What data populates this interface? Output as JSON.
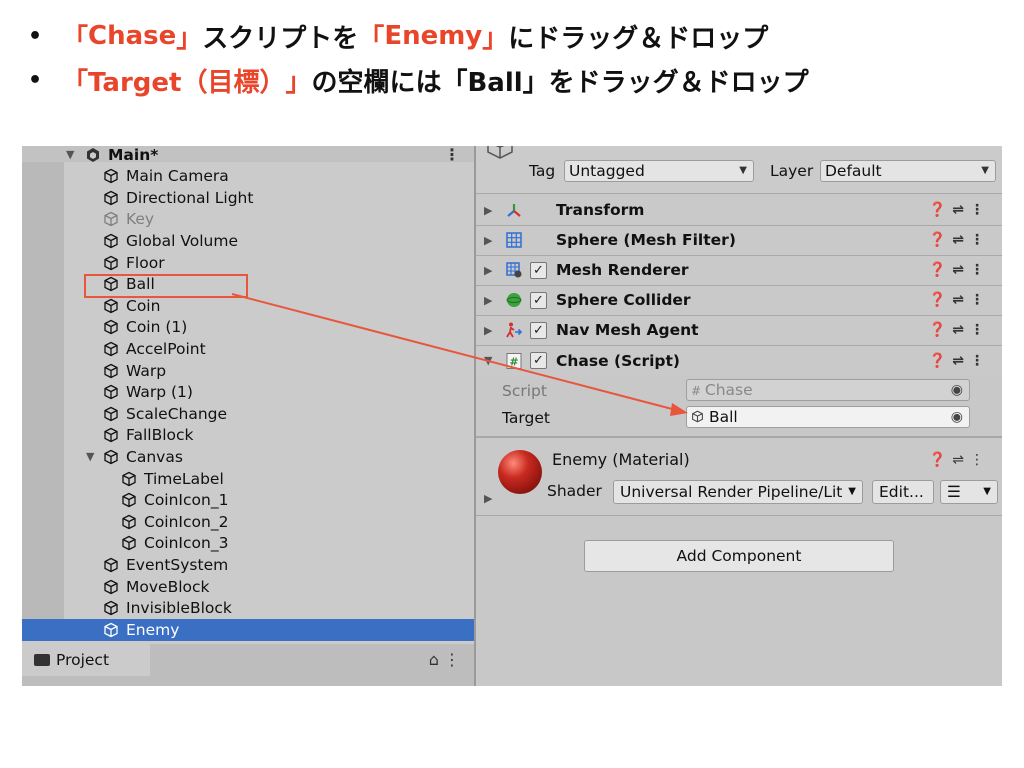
{
  "instructions": [
    {
      "open": "「",
      "hl": "Chase",
      "close": "」",
      "mid": "スクリプトを",
      "open2": "「",
      "hl2": "Enemy",
      "close2": "」",
      "tail": "にドラッグ＆ドロップ"
    },
    {
      "open": "「",
      "hl": "Target（目標）",
      "close": "」",
      "mid": "の空欄には「Ball」をドラッグ＆ドロップ"
    }
  ],
  "bullet": "•",
  "hierarchy": {
    "scene": "Main*",
    "items": [
      {
        "label": "Main Camera"
      },
      {
        "label": "Directional Light"
      },
      {
        "label": "Key"
      },
      {
        "label": "Global Volume"
      },
      {
        "label": "Floor"
      },
      {
        "label": "Ball"
      },
      {
        "label": "Coin"
      },
      {
        "label": "Coin (1)"
      },
      {
        "label": "AccelPoint"
      },
      {
        "label": "Warp"
      },
      {
        "label": "Warp (1)"
      },
      {
        "label": "ScaleChange"
      },
      {
        "label": "FallBlock"
      },
      {
        "label": "Canvas"
      },
      {
        "label": "TimeLabel"
      },
      {
        "label": "CoinIcon_1"
      },
      {
        "label": "CoinIcon_2"
      },
      {
        "label": "CoinIcon_3"
      },
      {
        "label": "EventSystem"
      },
      {
        "label": "MoveBlock"
      },
      {
        "label": "InvisibleBlock"
      },
      {
        "label": "Enemy"
      }
    ]
  },
  "project": {
    "tab": "Project"
  },
  "inspector": {
    "tag_label": "Tag",
    "tag_value": "Untagged",
    "layer_label": "Layer",
    "layer_value": "Default",
    "components": [
      {
        "name": "Transform"
      },
      {
        "name": "Sphere (Mesh Filter)"
      },
      {
        "name": "Mesh Renderer"
      },
      {
        "name": "Sphere Collider"
      },
      {
        "name": "Nav Mesh Agent"
      },
      {
        "name": "Chase (Script)"
      }
    ],
    "script_label": "Script",
    "script_value": "Chase",
    "target_label": "Target",
    "target_value": "Ball",
    "material_name": "Enemy (Material)",
    "shader_label": "Shader",
    "shader_value": "Universal Render Pipeline/Lit",
    "edit_button": "Edit...",
    "add_component": "Add Component"
  },
  "colors": {
    "highlight": "#e8452b",
    "selection": "#3a6fc4",
    "annotation": "#e8563e"
  }
}
